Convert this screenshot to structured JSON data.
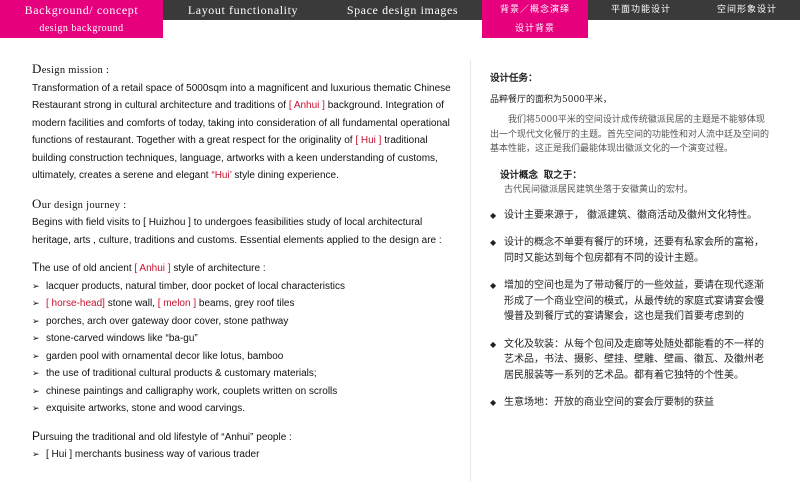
{
  "nav": {
    "tabs_en": [
      "Background/ concept",
      "Layout functionality",
      "Space design images"
    ],
    "subtab_en": "design background",
    "tabs_cn": [
      "背景／概念演绎",
      "平面功能设计",
      "空间形象设计"
    ],
    "subtab_cn": "设计背景"
  },
  "colors": {
    "accent": "#e6007e",
    "nav_bg": "#3a3a3a",
    "highlight": "#c8102e"
  },
  "english": {
    "mission_title_initial": "D",
    "mission_title_rest": "esign mission :",
    "mission_p1": "Transformation of a retail space of 5000sqm into a magnificent and luxurious thematic Chinese Restaurant  strong in cultural architecture and traditions of ",
    "mission_hl1": "[ Anhui ]",
    "mission_p2": " background. Integration of modern facilities and comforts of today, taking into consideration of all fundamental operational functions of restaurant.  Together with a great respect for the originality of ",
    "mission_hl2": "[ Hui ]",
    "mission_p3": " traditional building construction techniques, language, artworks with  a keen understanding of customs, ultimately,  creates a serene and elegant ",
    "mission_hl3": "“Hui’",
    "mission_p4": "  style dining experience.",
    "journey_title_initial": "O",
    "journey_title_rest": "ur design journey :",
    "journey_p": " Begins with field visits to [ Huizhou ]  to undergoes feasibilities study  of local architectural heritage, arts , culture, traditions and customs. Essential elements applied to the design are :",
    "use_initial": "T",
    "use_p1": "he use of old ancient ",
    "use_hl": "[ Anhui ]",
    "use_p2": " style of architecture :",
    "b1": "lacquer products, natural timber, door pocket of local characteristics",
    "b2_hl": "[ horse-head]",
    "b2_mid": " stone wall, ",
    "b2_hl2": "[ melon ]",
    "b2_end": " beams,  grey roof tiles",
    "b3": "porches, arch over gateway door cover, stone pathway",
    "b4": "stone-carved windows like   “ba-gu”",
    "b5": "garden pool with ornamental decor like lotus, bamboo",
    "b6": "the use of traditional cultural products & customary materials;",
    "b7": "chinese paintings and calligraphy work, couplets written on scrolls",
    "b8": "exquisite artworks, stone and wood carvings.",
    "pursue_initial": "P",
    "pursue_rest": "ursuing the traditional and old lifestyle of   “Anhui” people :",
    "b9": "[ Hui ] merchants business way  of various trader"
  },
  "chinese": {
    "task_title": "设计任务：",
    "task_line": "品粹餐厅的面积为5000平米，",
    "task_para": "我们将5000平米的空间设计成传统徽派民居的主题是不能够体现出一个现代文化餐厅的主题。首先空间的功能性和对人流中廷及空间的基本性能，这正是我们最能体现出徽派文化的一个演变过程。",
    "concept_title": "设计概念 取之于：",
    "concept_line": "古代民间徽派居民建筑坐落于安徽黄山的宏村。",
    "items": [
      "设计主要来源于， 徽派建筑、徽商活动及徽州文化特性。",
      "设计的概念不单要有餐厅的环境，还要有私家会所的富裕，同时又能达到每个包房都有不同的设计主题。",
      "增加的空间也是为了带动餐厅的一些效益，要请在现代逐渐形成了一个商业空间的模式，从最传统的家庭式宴请宴会慢慢普及到餐厅式的宴请聚会，这也是我们首要考虑到的",
      "文化及软装：从每个包间及走廊等处随处都能看的不一样的艺术品，书法、摄影、壁挂、壁雕、壁画、徽瓦、及徽州老居民服装等一系列的艺术品。都有着它独特的个性美。",
      "生意场地：开放的商业空间的宴会厅要制的获益"
    ]
  }
}
